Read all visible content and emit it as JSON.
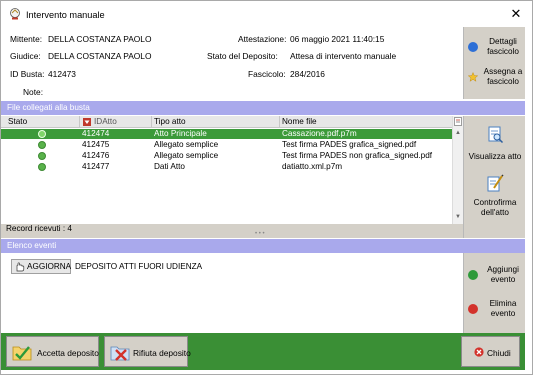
{
  "window": {
    "title": "Intervento manuale",
    "close_glyph": "✕"
  },
  "info": {
    "mittente_label": "Mittente:",
    "mittente": "DELLA COSTANZA PAOLO",
    "giudice_label": "Giudice:",
    "giudice": "DELLA COSTANZA PAOLO",
    "busta_label": "ID Busta:",
    "busta": "412473",
    "note_label": "Note:",
    "attestazione_label": "Attestazione:",
    "attestazione": "06 maggio 2021 11:40:15",
    "stato_label": "Stato del Deposito:",
    "stato": "Attesa di intervento manuale",
    "fascicolo_label": "Fascicolo:",
    "fascicolo": "284/2016"
  },
  "side_top": {
    "dettagli": "Dettagli fascicolo",
    "assegna": "Assegna a fascicolo"
  },
  "files": {
    "header": "File collegati alla busta",
    "columns": {
      "stato": "Stato",
      "idatto": "IDAtto",
      "tipo": "Tipo atto",
      "nome": "Nome file"
    },
    "rows": [
      {
        "id": "412474",
        "tipo": "Atto Principale",
        "nome": "Cassazione.pdf.p7m",
        "selected": true
      },
      {
        "id": "412475",
        "tipo": "Allegato semplice",
        "nome": "Test firma PADES grafica_signed.pdf",
        "selected": false
      },
      {
        "id": "412476",
        "tipo": "Allegato semplice",
        "nome": "Test firma PADES non grafica_signed.pdf",
        "selected": false
      },
      {
        "id": "412477",
        "tipo": "Dati Atto",
        "nome": "datiatto.xml.p7m",
        "selected": false
      }
    ],
    "records": "Record ricevuti : 4"
  },
  "side_mid": {
    "visualizza": "Visualizza atto",
    "controfirma": "Controfirma dell'atto"
  },
  "events": {
    "header": "Elenco eventi",
    "refresh_label": "AGGIORNA",
    "event_text": "DEPOSITO ATTI FUORI UDIENZA"
  },
  "side_bottom": {
    "aggiungi": "Aggiungi evento",
    "elimina": "Elimina evento"
  },
  "footer": {
    "accetta": "Accetta deposito",
    "rifiuta": "Rifiuta deposito",
    "chiudi": "Chiudi"
  },
  "colors": {
    "accent_green": "#3a8f35",
    "section_header": "#a9a9ec",
    "selection": "#3c9a3a"
  }
}
